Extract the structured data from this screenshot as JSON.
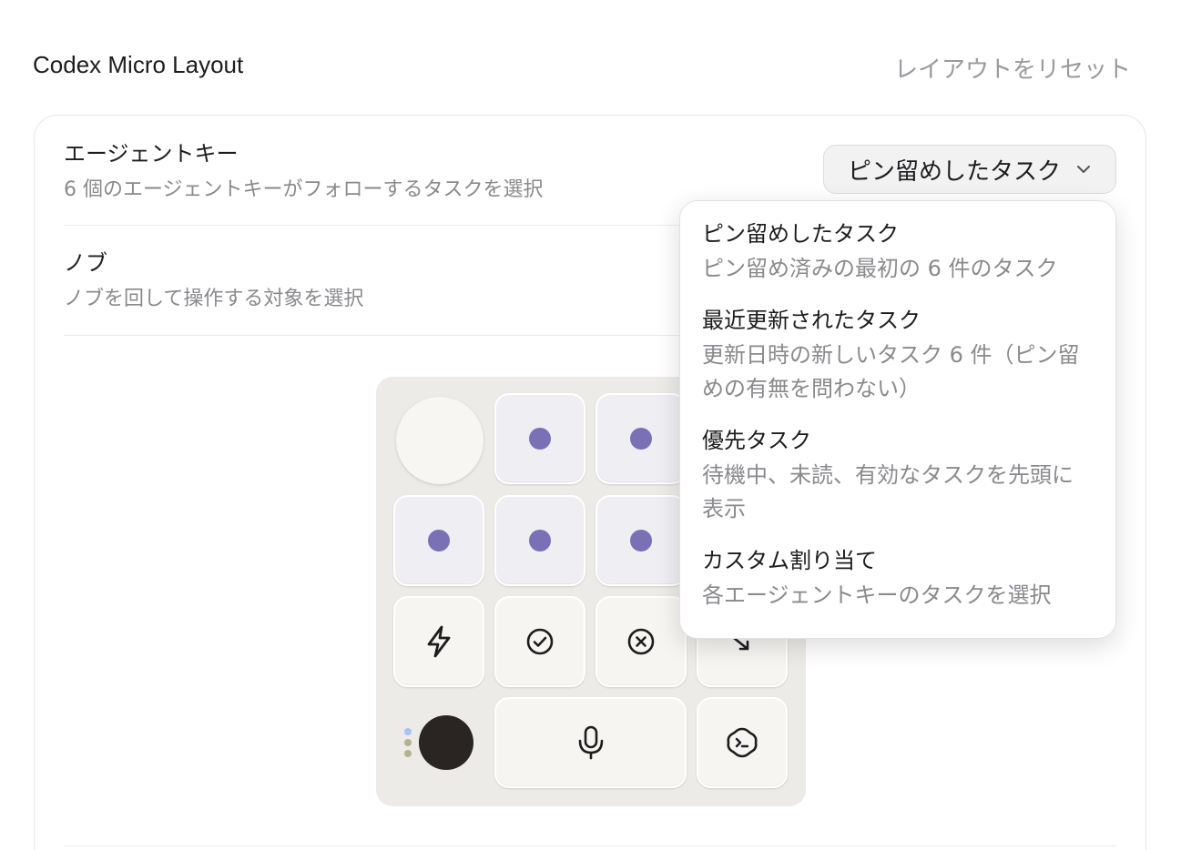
{
  "header": {
    "title": "Codex Micro Layout",
    "reset_label": "レイアウトをリセット"
  },
  "settings": {
    "agent_keys": {
      "title": "エージェントキー",
      "subtitle": "6 個のエージェントキーがフォローするタスクを選択",
      "selected": "ピン留めしたタスク"
    },
    "knob": {
      "title": "ノブ",
      "subtitle": "ノブを回して操作する対象を選択"
    }
  },
  "dropdown": {
    "options": [
      {
        "title": "ピン留めしたタスク",
        "description": "ピン留め済みの最初の 6 件のタスク"
      },
      {
        "title": "最近更新されたタスク",
        "description": "更新日時の新しいタスク 6 件（ピン留めの有無を問わない）"
      },
      {
        "title": "優先タスク",
        "description": "待機中、未読、有効なタスクを先頭に表示"
      },
      {
        "title": "カスタム割り当て",
        "description": "各エージェントキーのタスクを選択"
      }
    ]
  },
  "device": {
    "agent_key_color": "#7a70b6",
    "icons": [
      "bolt-icon",
      "check-circle-icon",
      "x-circle-icon",
      "arrow-down-right-icon",
      "microphone-icon",
      "terminal-icon"
    ],
    "led_colors": [
      "#a8c4f5",
      "#b3b38f",
      "#b3b38f"
    ]
  }
}
